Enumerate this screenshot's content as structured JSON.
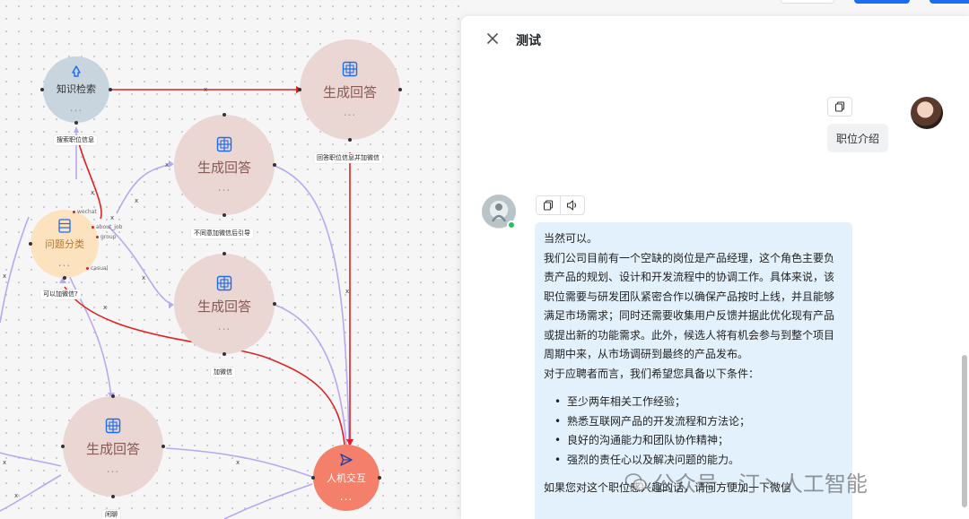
{
  "flow": {
    "nodes": {
      "knowledge_search": {
        "title": "知识检索",
        "dots": "..."
      },
      "gen1": {
        "title": "生成回答",
        "dots": "..."
      },
      "gen2": {
        "title": "生成回答",
        "dots": "..."
      },
      "gen3": {
        "title": "生成回答",
        "dots": "..."
      },
      "gen4": {
        "title": "生成回答",
        "dots": "..."
      },
      "classifier": {
        "title": "问题分类",
        "dots": "..."
      },
      "human": {
        "title": "人机交互",
        "dots": "..."
      }
    },
    "edge_labels": {
      "search_job": "搜索职位信息",
      "answer_job_wechat": "回答职位信息并加微信",
      "no_add_wechat": "不同意加微信后引导",
      "can_add_wechat": "可以加微信?",
      "add_wechat": "加微信",
      "bottom_label": "闲聊"
    },
    "class_ports": [
      "wechat",
      "about_job",
      "group",
      "casual"
    ],
    "x_mark": "x"
  },
  "panel": {
    "title": "测试",
    "user_message": "职位介绍",
    "bot_message": {
      "paragraphs": [
        "当然可以。",
        "我们公司目前有一个空缺的岗位是产品经理，这个角色主要负责产品的规划、设计和开发流程中的协调工作。具体来说，该职位需要与研发团队紧密合作以确保产品按时上线，并且能够满足市场需求；同时还需要收集用户反馈并据此优化现有产品或提出新的功能需求。此外，候选人将有机会参与到整个项目周期中来，从市场调研到最终的产品发布。",
        "对于应聘者而言，我们希望您具备以下条件："
      ],
      "requirements": [
        "至少两年相关工作经验；",
        "熟悉互联网产品的开发流程和方法论；",
        "良好的沟通能力和团队协作精神；",
        "强烈的责任心以及解决问题的能力。"
      ],
      "closing": "如果您对这个职位感兴趣的话，请问方便加一下微信"
    }
  },
  "watermark": {
    "text": "公众号 · 汀丶人工智能"
  },
  "colors": {
    "accent_blue": "#1a6cf0",
    "edge_red": "#e02020",
    "edge_purple": "#b9a7f0",
    "human_node": "#f47f6a",
    "bubble_bot": "#e3f1fd",
    "online_dot": "#21c25e"
  }
}
